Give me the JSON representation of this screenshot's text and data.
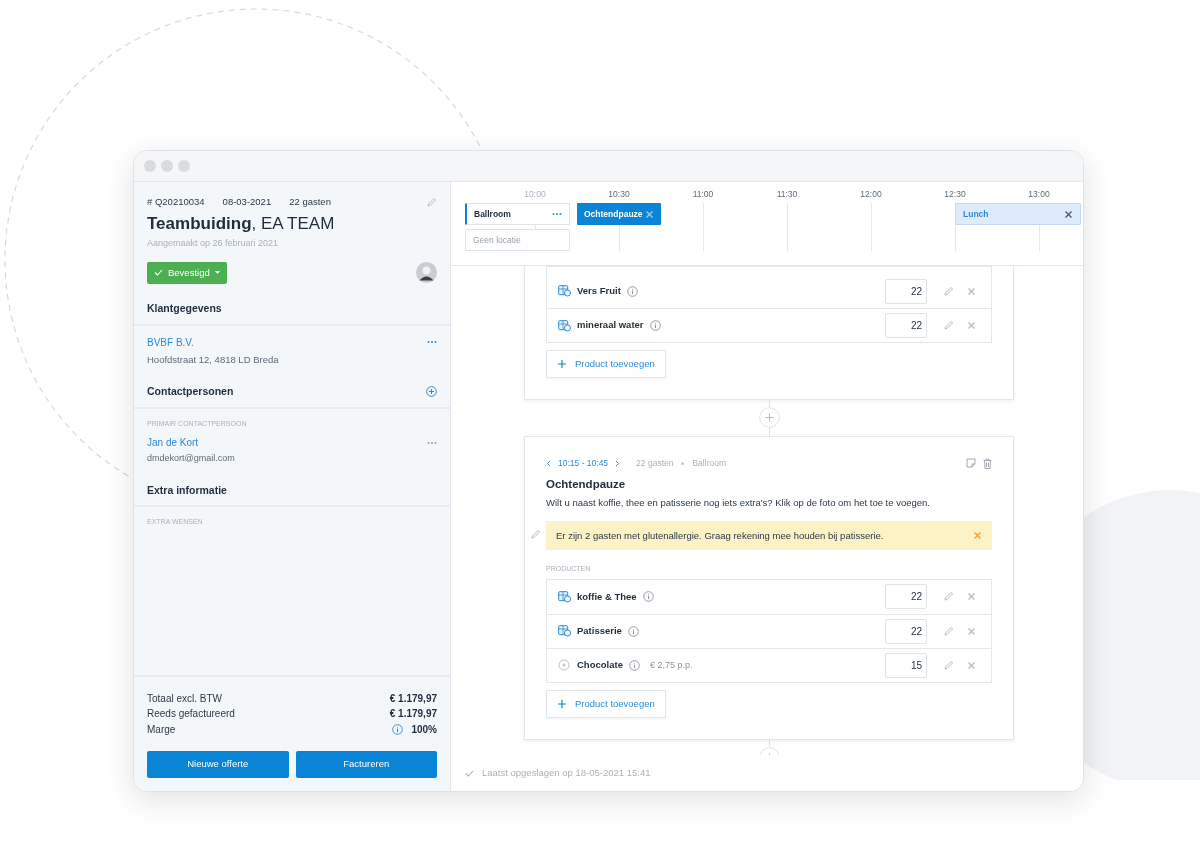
{
  "sidebar": {
    "number": "# Q20210034",
    "date": "08-03-2021",
    "guests": "22 gasten",
    "title": "**Teambuiding**, EA TEAM",
    "created": "Aangemaakt op 26 februari 2021",
    "status": "Bevestigd",
    "customer": {
      "heading": "Klantgegevens",
      "name": "BVBF B.V.",
      "address": "Hoofdstraat 12, 4818 LD Breda"
    },
    "contacts": {
      "heading": "Contactpersonen",
      "label": "PRIMAIR CONTACTPERSOON",
      "name": "Jan de Kort",
      "email": "dmdekort@gmail.com"
    },
    "extra": {
      "heading": "Extra informatie",
      "label": "EXTRA WENSEN"
    },
    "totals": [
      {
        "label": "Totaal excl. BTW",
        "value": "€ 1.179,97",
        "kind": "amount"
      },
      {
        "label": "Reeds gefactureerd",
        "value": "€ 1.179,97",
        "kind": "amount"
      },
      {
        "label": "Marge",
        "value": "100%",
        "kind": "info"
      }
    ],
    "buttons": [
      "Nieuwe offerte",
      "Factureren"
    ]
  },
  "timeline": {
    "times": [
      "10:00",
      "10:30",
      "11:00",
      "11:30",
      "12:00",
      "12:30",
      "13:00"
    ],
    "events": [
      {
        "label": "Ballroom",
        "kind": "room"
      },
      {
        "label": "Geen locatie",
        "kind": "placeholder"
      },
      {
        "label": "Ochtendpauze",
        "kind": "selected"
      },
      {
        "label": "Lunch",
        "kind": "light"
      }
    ]
  },
  "blocks": [
    {
      "products": [
        {
          "name": "Vers Fruit",
          "quantity": "22",
          "kind": "package"
        },
        {
          "name": "mineraal water",
          "quantity": "22",
          "kind": "package"
        }
      ],
      "add_label": "Product toevoegen"
    },
    {
      "time": "10:15 - 10:45",
      "guests": "22 gasten",
      "room": "Ballroom",
      "title": "Ochtendpauze",
      "description": "Wilt u naast koffie, thee en patisserie nog iets extra's? Klik op de foto om het toe te voegen.",
      "note": "Er zijn 2 gasten met glutenallergie. Graag rekening mee houden bij patisserie.",
      "products_label": "PRODUCTEN",
      "products": [
        {
          "name": "koffie & Thee",
          "quantity": "22",
          "kind": "package"
        },
        {
          "name": "Patisserie",
          "quantity": "22",
          "kind": "package"
        },
        {
          "name": "Chocolate",
          "quantity": "15",
          "kind": "optional",
          "price": "€ 2,75 p.p."
        }
      ],
      "add_label": "Product toevoegen"
    }
  ],
  "status_bar": "Laatst opgeslagen op 18-05-2021 15:41"
}
